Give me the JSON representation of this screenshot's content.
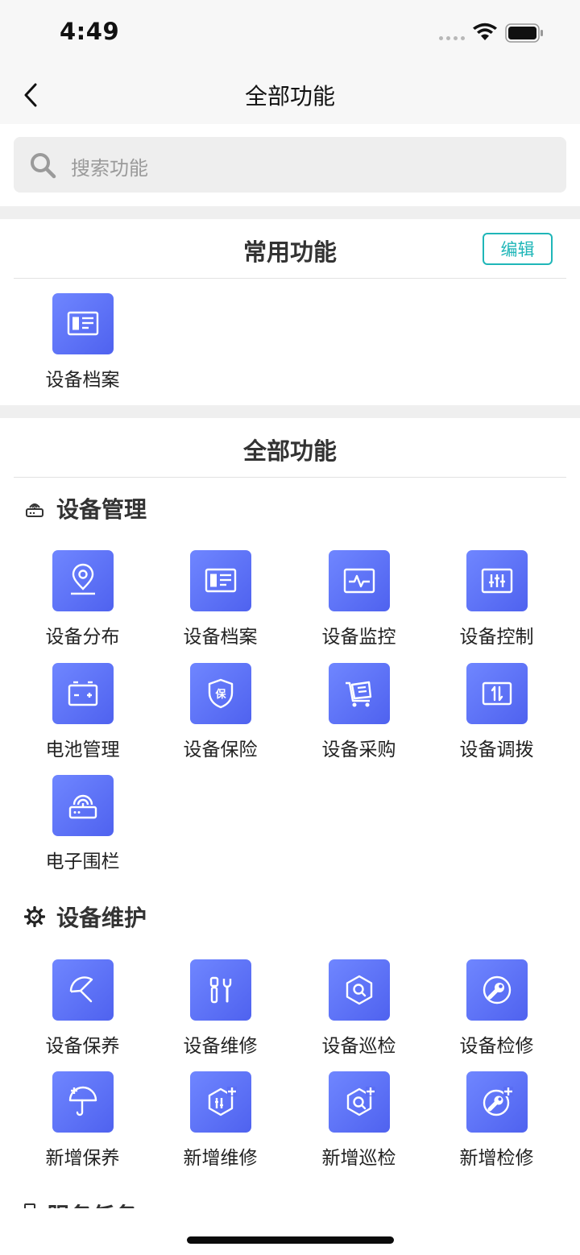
{
  "status_bar": {
    "time": "4:49"
  },
  "nav": {
    "title": "全部功能"
  },
  "search": {
    "placeholder": "搜索功能"
  },
  "frequent": {
    "title": "常用功能",
    "edit_label": "编辑",
    "items": [
      {
        "label": "设备档案",
        "icon": "id-card-icon"
      }
    ]
  },
  "all_functions": {
    "title": "全部功能",
    "categories": [
      {
        "title": "设备管理",
        "icon": "router-icon",
        "items": [
          {
            "label": "设备分布",
            "icon": "location-pin-icon"
          },
          {
            "label": "设备档案",
            "icon": "id-card-icon"
          },
          {
            "label": "设备监控",
            "icon": "pulse-monitor-icon"
          },
          {
            "label": "设备控制",
            "icon": "sliders-icon"
          },
          {
            "label": "电池管理",
            "icon": "battery-icon"
          },
          {
            "label": "设备保险",
            "icon": "shield-icon"
          },
          {
            "label": "设备采购",
            "icon": "cart-icon"
          },
          {
            "label": "设备调拨",
            "icon": "transfer-icon"
          },
          {
            "label": "电子围栏",
            "icon": "router-icon"
          }
        ]
      },
      {
        "title": "设备维护",
        "icon": "gear-icon",
        "items": [
          {
            "label": "设备保养",
            "icon": "umbrella-icon"
          },
          {
            "label": "设备维修",
            "icon": "tools-icon"
          },
          {
            "label": "设备巡检",
            "icon": "inspect-icon"
          },
          {
            "label": "设备检修",
            "icon": "wrench-circle-icon"
          },
          {
            "label": "新增保养",
            "icon": "add-umbrella-icon"
          },
          {
            "label": "新增维修",
            "icon": "add-tools-icon"
          },
          {
            "label": "新增巡检",
            "icon": "add-inspect-icon"
          },
          {
            "label": "新增检修",
            "icon": "add-wrench-icon"
          }
        ]
      },
      {
        "title": "服务任务",
        "icon": "task-icon",
        "items": []
      }
    ]
  },
  "colors": {
    "accent": "#1fb6b8",
    "tile_start": "#6f86ff",
    "tile_end": "#4f62ef"
  }
}
